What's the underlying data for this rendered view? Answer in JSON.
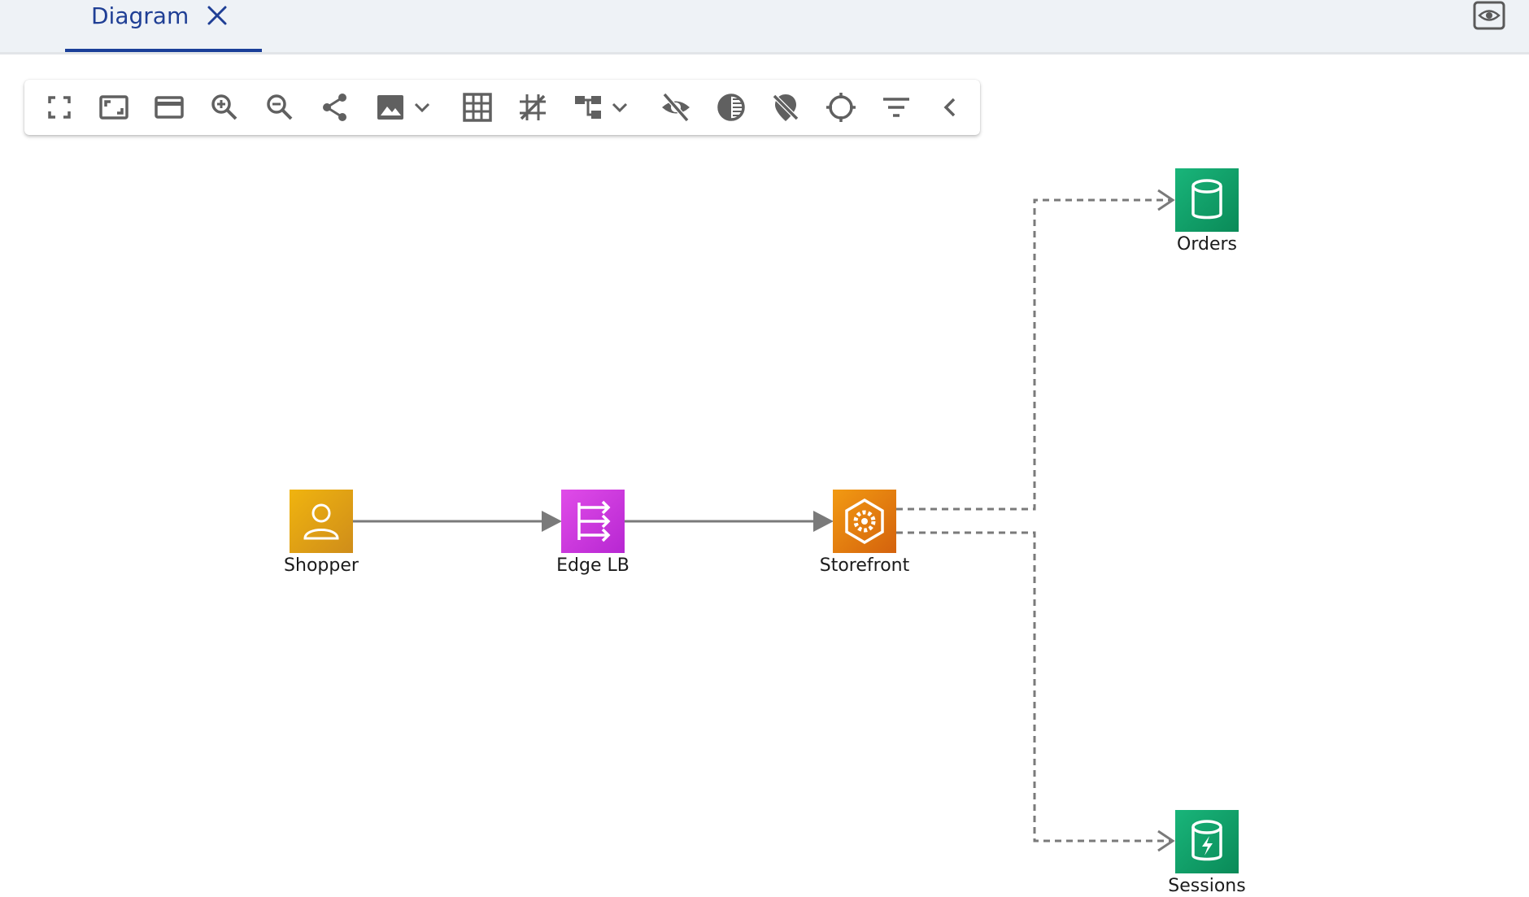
{
  "tabs": [
    {
      "label": "Diagram",
      "close_icon": "close-icon"
    }
  ],
  "header": {
    "preview_icon": "eye-icon"
  },
  "toolbar": {
    "buttons": [
      {
        "name": "fullscreen",
        "icon": "fullscreen-icon"
      },
      {
        "name": "fit-to-screen",
        "icon": "fit-screen-icon"
      },
      {
        "name": "actual-size",
        "icon": "card-icon"
      },
      {
        "name": "zoom-in",
        "icon": "zoom-in-icon"
      },
      {
        "name": "zoom-out",
        "icon": "zoom-out-icon"
      },
      {
        "name": "share",
        "icon": "share-icon"
      },
      {
        "name": "export-image",
        "icon": "image-icon",
        "has_dropdown": true
      },
      {
        "name": "grid",
        "icon": "grid-icon"
      },
      {
        "name": "snap",
        "icon": "snap-icon"
      },
      {
        "name": "layout",
        "icon": "hierarchy-icon",
        "has_dropdown": true
      },
      {
        "name": "hide",
        "icon": "eye-off-icon"
      },
      {
        "name": "contrast",
        "icon": "contrast-icon"
      },
      {
        "name": "pin-off",
        "icon": "pin-off-icon"
      },
      {
        "name": "center",
        "icon": "crosshair-icon"
      },
      {
        "name": "filter",
        "icon": "filter-icon"
      },
      {
        "name": "collapse",
        "icon": "chevron-left-icon"
      }
    ]
  },
  "diagram": {
    "nodes": [
      {
        "id": "shopper",
        "label": "Shopper",
        "icon": "user-icon",
        "color": "#e3a21a"
      },
      {
        "id": "edge-lb",
        "label": "Edge LB",
        "icon": "load-balancer-icon",
        "color": "#c93be0"
      },
      {
        "id": "storefront",
        "label": "Storefront",
        "icon": "gear-hexagon-icon",
        "color": "#e2800f"
      },
      {
        "id": "orders",
        "label": "Orders",
        "icon": "database-icon",
        "color": "#12a06a"
      },
      {
        "id": "sessions",
        "label": "Sessions",
        "icon": "database-bolt-icon",
        "color": "#12a06a"
      }
    ],
    "edges": [
      {
        "from": "Shopper",
        "to": "Edge LB",
        "style": "solid"
      },
      {
        "from": "Edge LB",
        "to": "Storefront",
        "style": "solid"
      },
      {
        "from": "Storefront",
        "to": "Orders",
        "style": "dashed"
      },
      {
        "from": "Storefront",
        "to": "Sessions",
        "style": "dashed"
      }
    ]
  }
}
